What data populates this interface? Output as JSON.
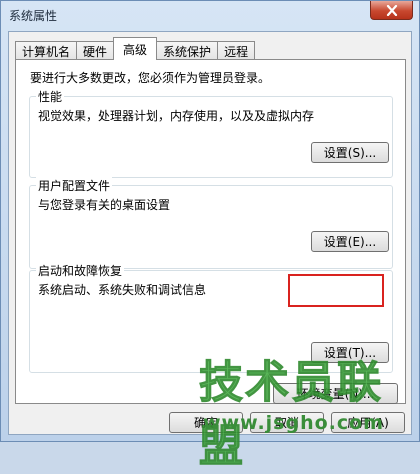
{
  "window": {
    "title": "系统属性"
  },
  "tabs": [
    {
      "label": "计算机名",
      "active": false
    },
    {
      "label": "硬件",
      "active": false
    },
    {
      "label": "高级",
      "active": true
    },
    {
      "label": "系统保护",
      "active": false
    },
    {
      "label": "远程",
      "active": false
    }
  ],
  "advanced": {
    "admin_note": "要进行大多数更改，您必须作为管理员登录。",
    "performance": {
      "label": "性能",
      "description": "视觉效果，处理器计划，内存使用，以及及虚拟内存",
      "button": "设置(S)..."
    },
    "user_profiles": {
      "label": "用户配置文件",
      "description": "与您登录有关的桌面设置",
      "button": "设置(E)..."
    },
    "startup_recovery": {
      "label": "启动和故障恢复",
      "description": "系统启动、系统失败和调试信息",
      "button": "设置(T)..."
    },
    "env_button": "环境变量(N)..."
  },
  "bottom_buttons": {
    "ok": "确定",
    "cancel": "取消",
    "apply": "应用(A)"
  },
  "watermark": {
    "brand": "技术员联盟",
    "url": "www.jsgho.com"
  },
  "colors": {
    "highlight": "#d9231f",
    "watermark": "#49b048",
    "close_button": "#c8482f"
  }
}
